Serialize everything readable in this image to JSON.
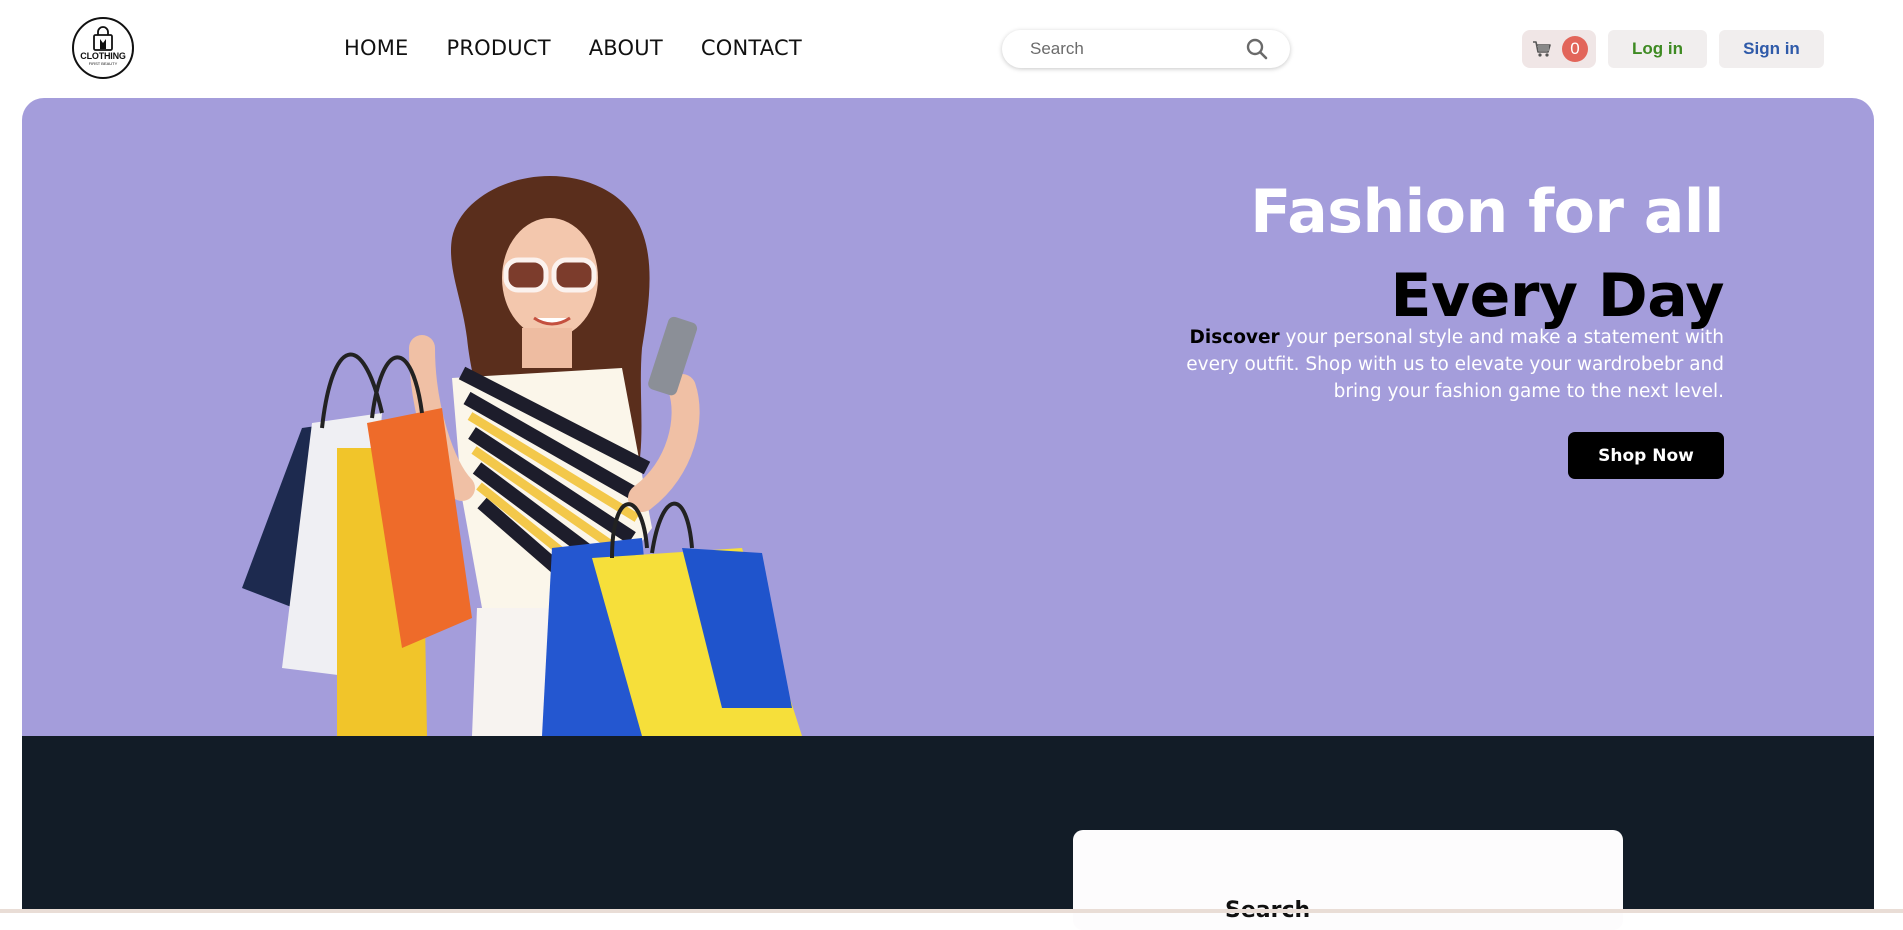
{
  "brand": {
    "logo_text": "CLOTHING",
    "logo_subtext": "FIRST BEAUTY"
  },
  "nav": {
    "links": [
      "HOME",
      "PRODUCT",
      "ABOUT",
      "CONTACT"
    ]
  },
  "search": {
    "placeholder": "Search",
    "icon": "search-icon"
  },
  "cart": {
    "icon": "cart-icon",
    "count": "0"
  },
  "auth": {
    "login_label": "Log in",
    "signin_label": "Sign in"
  },
  "hero": {
    "title_line1": "Fashion for all",
    "title_line2": "Every Day",
    "desc_bold": "Discover",
    "desc_rest": " your personal style and make a statement with every outfit. Shop with us to elevate your wardrobebr and bring your fashion game to the next level.",
    "cta_label": "Shop Now",
    "background_color": "#a49ddb"
  },
  "lower_section": {
    "card_heading": "Search",
    "background_color": "#121c27"
  },
  "colors": {
    "login_text": "#3e8a22",
    "signin_text": "#2f5aa9",
    "cart_badge": "#e2655a"
  }
}
